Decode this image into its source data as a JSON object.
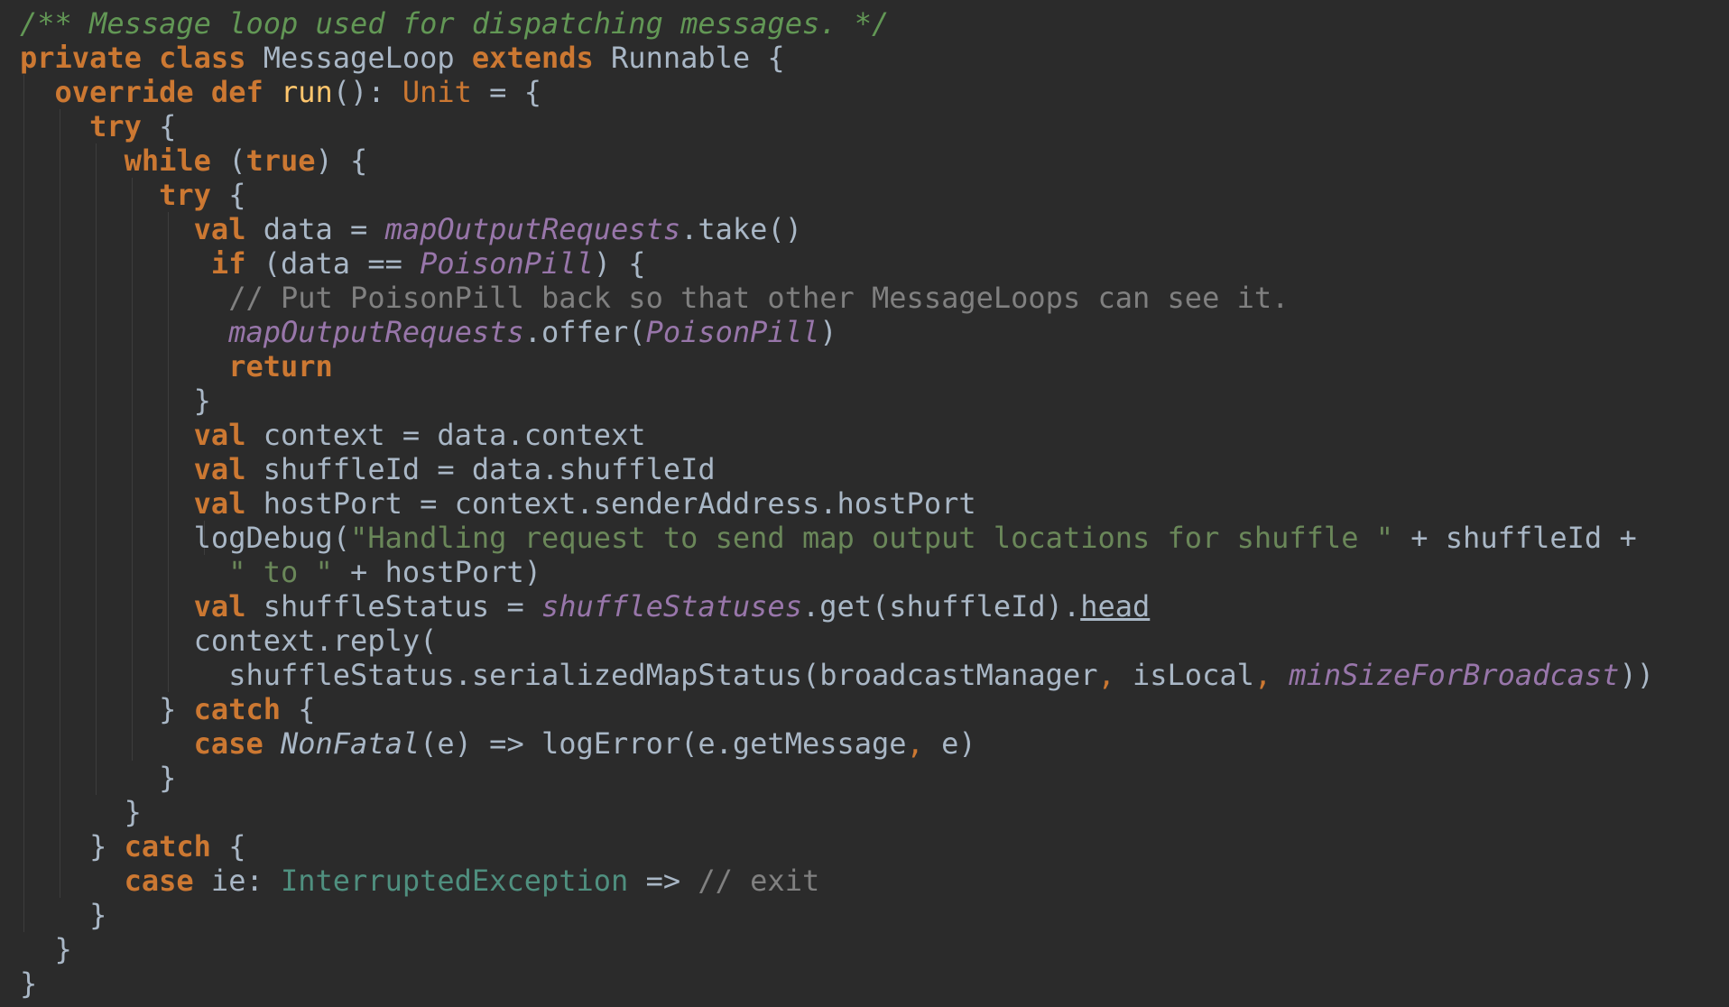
{
  "lines": [
    [
      {
        "t": "/** Message loop used for dispatching messages. */",
        "c": "doc"
      }
    ],
    [
      {
        "t": "private",
        "c": "kw"
      },
      {
        "t": " "
      },
      {
        "t": "class",
        "c": "kw"
      },
      {
        "t": " MessageLoop "
      },
      {
        "t": "extends",
        "c": "kw"
      },
      {
        "t": " Runnable {"
      }
    ],
    [
      {
        "t": "  "
      },
      {
        "t": "override",
        "c": "kw"
      },
      {
        "t": " "
      },
      {
        "t": "def",
        "c": "kw"
      },
      {
        "t": " "
      },
      {
        "t": "run",
        "c": "fn"
      },
      {
        "t": "(): "
      },
      {
        "t": "Unit",
        "c": "typ"
      },
      {
        "t": " = {"
      }
    ],
    [
      {
        "t": "    "
      },
      {
        "t": "try",
        "c": "kw"
      },
      {
        "t": " {"
      }
    ],
    [
      {
        "t": "      "
      },
      {
        "t": "while",
        "c": "kw"
      },
      {
        "t": " ("
      },
      {
        "t": "true",
        "c": "kw"
      },
      {
        "t": ") {"
      }
    ],
    [
      {
        "t": "        "
      },
      {
        "t": "try",
        "c": "kw"
      },
      {
        "t": " {"
      }
    ],
    [
      {
        "t": "          "
      },
      {
        "t": "val",
        "c": "kw"
      },
      {
        "t": " data = "
      },
      {
        "t": "mapOutputRequests",
        "c": "fld"
      },
      {
        "t": ".take()"
      }
    ],
    [
      {
        "t": "           "
      },
      {
        "t": "if",
        "c": "kw"
      },
      {
        "t": " (data == "
      },
      {
        "t": "PoisonPill",
        "c": "fld"
      },
      {
        "t": ") {"
      }
    ],
    [
      {
        "t": "            "
      },
      {
        "t": "// Put PoisonPill back so that other MessageLoops can see it.",
        "c": "cmt"
      }
    ],
    [
      {
        "t": "            "
      },
      {
        "t": "mapOutputRequests",
        "c": "fld"
      },
      {
        "t": ".offer("
      },
      {
        "t": "PoisonPill",
        "c": "fld"
      },
      {
        "t": ")"
      }
    ],
    [
      {
        "t": "            "
      },
      {
        "t": "return",
        "c": "kw"
      }
    ],
    [
      {
        "t": "          }"
      }
    ],
    [
      {
        "t": "          "
      },
      {
        "t": "val",
        "c": "kw"
      },
      {
        "t": " context = data.context"
      }
    ],
    [
      {
        "t": "          "
      },
      {
        "t": "val",
        "c": "kw"
      },
      {
        "t": " shuffleId = data.shuffleId"
      }
    ],
    [
      {
        "t": "          "
      },
      {
        "t": "val",
        "c": "kw"
      },
      {
        "t": " hostPort = context.senderAddress.hostPort"
      }
    ],
    [
      {
        "t": "          logDebug("
      },
      {
        "t": "\"Handling request to send map output locations for shuffle \"",
        "c": "str"
      },
      {
        "t": " + shuffleId +"
      }
    ],
    [
      {
        "t": "            "
      },
      {
        "t": "\" to \"",
        "c": "str"
      },
      {
        "t": " + hostPort)"
      }
    ],
    [
      {
        "t": "          "
      },
      {
        "t": "val",
        "c": "kw"
      },
      {
        "t": " shuffleStatus = "
      },
      {
        "t": "shuffleStatuses",
        "c": "fld"
      },
      {
        "t": ".get(shuffleId)."
      },
      {
        "t": "head",
        "c": "ul"
      }
    ],
    [
      {
        "t": "          context.reply("
      }
    ],
    [
      {
        "t": "            shuffleStatus.serializedMapStatus(broadcastManager"
      },
      {
        "t": ",",
        "c": "punc"
      },
      {
        "t": " isLocal"
      },
      {
        "t": ",",
        "c": "punc"
      },
      {
        "t": " "
      },
      {
        "t": "minSizeForBroadcast",
        "c": "fld"
      },
      {
        "t": "))"
      }
    ],
    [
      {
        "t": "        } "
      },
      {
        "t": "catch",
        "c": "kw"
      },
      {
        "t": " {"
      }
    ],
    [
      {
        "t": "          "
      },
      {
        "t": "case",
        "c": "kw"
      },
      {
        "t": " "
      },
      {
        "t": "NonFatal",
        "c": "ital"
      },
      {
        "t": "(e) => logError(e.getMessage"
      },
      {
        "t": ",",
        "c": "punc"
      },
      {
        "t": " e)"
      }
    ],
    [
      {
        "t": "        }"
      }
    ],
    [
      {
        "t": "      }"
      }
    ],
    [
      {
        "t": "    } "
      },
      {
        "t": "catch",
        "c": "kw"
      },
      {
        "t": " {"
      }
    ],
    [
      {
        "t": "      "
      },
      {
        "t": "case",
        "c": "kw"
      },
      {
        "t": " ie: "
      },
      {
        "t": "InterruptedException",
        "c": "exc"
      },
      {
        "t": " => "
      },
      {
        "t": "// exit",
        "c": "cmt"
      }
    ],
    [
      {
        "t": "    }"
      }
    ],
    [
      {
        "t": "  }"
      }
    ],
    [
      {
        "t": "}"
      }
    ]
  ]
}
